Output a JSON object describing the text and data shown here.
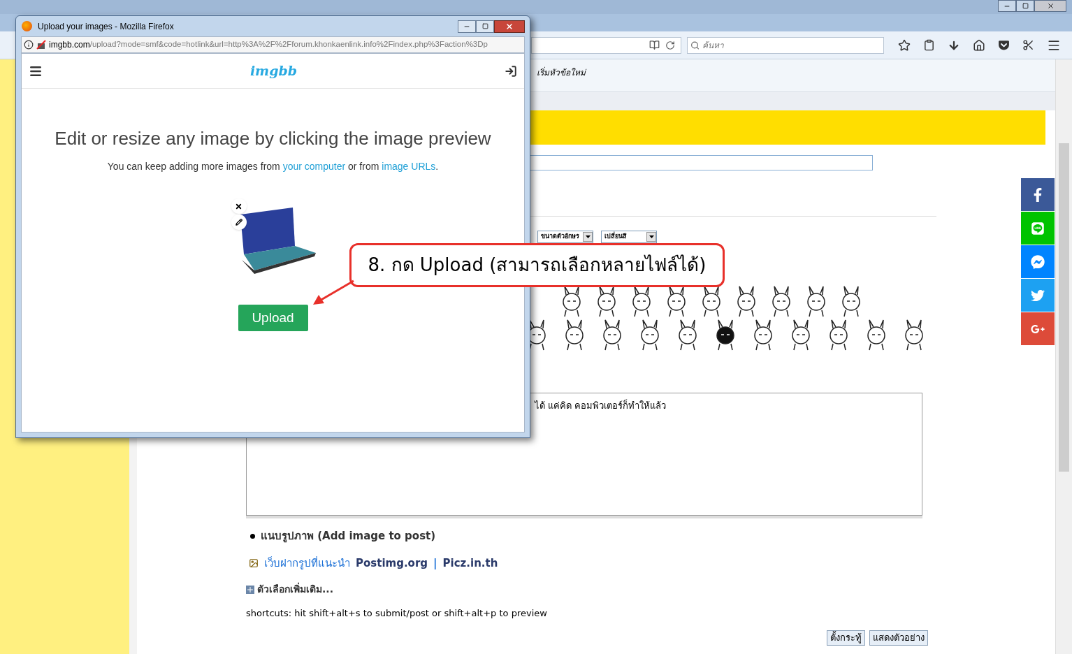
{
  "browser": {
    "search_placeholder": "ค้นหา"
  },
  "page": {
    "breadcrumb": "เริ่มหัวข้อใหม่",
    "dropdowns": [
      {
        "label": "ขนาดตัวอักษร"
      },
      {
        "label": "เปลี่ยนสี"
      }
    ],
    "message": "ได้ แค่คิด คอมพิวเตอร์ก็ทำให้แล้ว",
    "attach_heading": "แนบรูปภาพ (Add image to post)",
    "image_hosts": {
      "label": "เว็บฝากรูปที่แนะนำ",
      "links": [
        "Postimg.org",
        "Picz.in.th"
      ],
      "separator": "|"
    },
    "more_options": "ตัวเลือกเพิ่มเติม...",
    "shortcuts": "shortcuts: hit shift+alt+s to submit/post or shift+alt+p to preview",
    "buttons": [
      "ตั้งกระทู้",
      "แสดงตัวอย่าง"
    ]
  },
  "share_bar": [
    {
      "kind": "facebook",
      "color": "#3b5998"
    },
    {
      "kind": "line",
      "color": "#00c300"
    },
    {
      "kind": "messenger",
      "color": "#0084ff"
    },
    {
      "kind": "twitter",
      "color": "#1da1f2"
    },
    {
      "kind": "googleplus",
      "color": "#dd4b39"
    }
  ],
  "popup": {
    "title": "Upload your images - Mozilla Firefox",
    "url_host": "imgbb.com",
    "url_path": "/upload?mode=smf&code=hotlink&url=http%3A%2F%2Fforum.khonkaenlink.info%2Findex.php%3Faction%3Dp",
    "logo": "imgbb",
    "heading": "Edit or resize any image by clicking the image preview",
    "subtext": [
      {
        "kind": "text",
        "text": "You can keep adding more images from "
      },
      {
        "kind": "link",
        "text": "your computer"
      },
      {
        "kind": "text",
        "text": " or from "
      },
      {
        "kind": "link",
        "text": "image URLs"
      },
      {
        "kind": "text",
        "text": "."
      }
    ],
    "upload_button": "Upload"
  },
  "callout": {
    "text": "8. กด Upload (สามารถเลือกหลายไฟล์ได้)"
  }
}
